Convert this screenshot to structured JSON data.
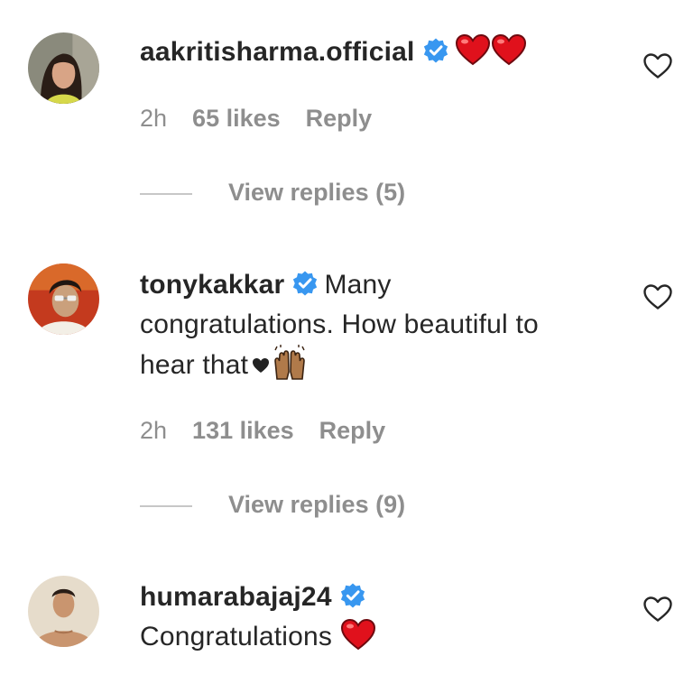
{
  "comments": [
    {
      "username": "aakritisharma.official",
      "verified": true,
      "text": "",
      "emojis": [
        "red-heart",
        "red-heart"
      ],
      "time": "2h",
      "likes": "65 likes",
      "reply_label": "Reply",
      "view_replies": "View replies (5)"
    },
    {
      "username": "tonykakkar",
      "verified": true,
      "text_line1": "Many",
      "text_line2": "congratulations. How beautiful to",
      "text_line3": "hear that",
      "emojis": [
        "black-heart",
        "raising-hands"
      ],
      "time": "2h",
      "likes": "131 likes",
      "reply_label": "Reply",
      "view_replies": "View replies (9)"
    },
    {
      "username": "humarabajaj24",
      "verified": true,
      "text": "Congratulations",
      "emojis": [
        "red-heart"
      ]
    }
  ],
  "colors": {
    "verified_blue": "#3897f0",
    "meta_gray": "#8e8e8e",
    "text": "#262626",
    "heart_red": "#e0111c"
  }
}
